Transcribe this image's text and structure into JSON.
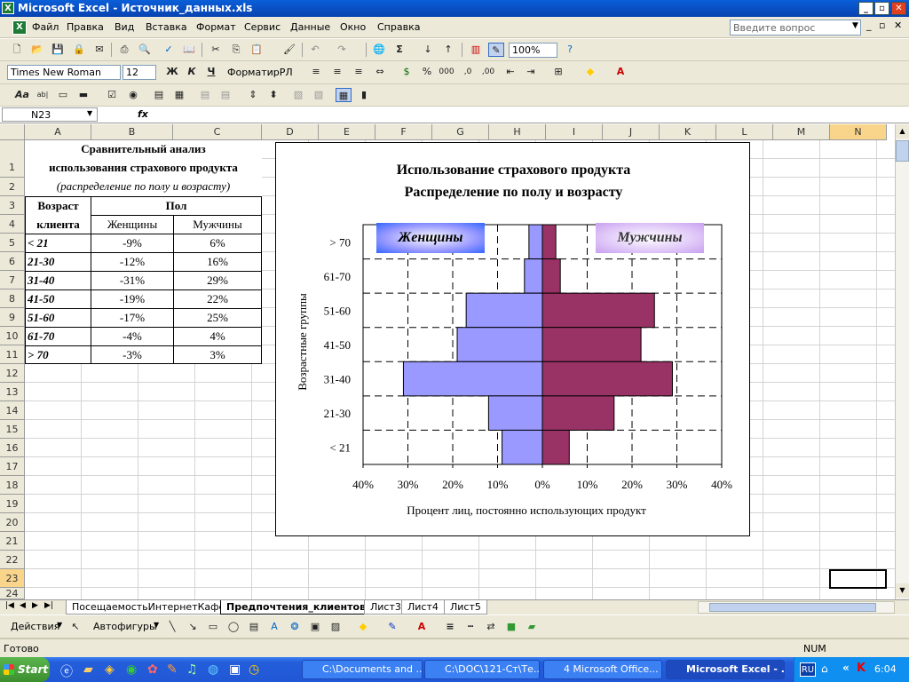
{
  "window": {
    "title": "Microsoft Excel - Источник_данных.xls"
  },
  "menu": [
    "Файл",
    "Правка",
    "Вид",
    "Вставка",
    "Формат",
    "Сервис",
    "Данные",
    "Окно",
    "Справка"
  ],
  "help_placeholder": "Введите вопрос",
  "toolbar": {
    "zoom": "100%",
    "font": "Times New Roman",
    "size": "12",
    "bold": "Ж",
    "italic": "К",
    "underline": "Ч",
    "format_btn": "ФорматирРЛ"
  },
  "formula_bar": {
    "cell": "N23",
    "fx": "fx",
    "value": ""
  },
  "columns": [
    "A",
    "B",
    "C",
    "D",
    "E",
    "F",
    "G",
    "H",
    "I",
    "J",
    "K",
    "L",
    "M",
    "N"
  ],
  "rows": [
    "1",
    "2",
    "3",
    "4",
    "5",
    "6",
    "7",
    "8",
    "9",
    "10",
    "11",
    "12",
    "13",
    "14",
    "15",
    "16",
    "17",
    "18",
    "19",
    "20",
    "21",
    "22",
    "23",
    "24"
  ],
  "table": {
    "title1": "Сравнительный анализ",
    "title2": "использования страхового продукта",
    "subtitle": "(распределение по полу и возрасту)",
    "h_age1": "Возраст",
    "h_age2": "клиента",
    "h_sex": "Пол",
    "h_women": "Женщины",
    "h_men": "Мужчины",
    "data": [
      {
        "age": "< 21",
        "women": "-9%",
        "men": "6%"
      },
      {
        "age": "21-30",
        "women": "-12%",
        "men": "16%"
      },
      {
        "age": "31-40",
        "women": "-31%",
        "men": "29%"
      },
      {
        "age": "41-50",
        "women": "-19%",
        "men": "22%"
      },
      {
        "age": "51-60",
        "women": "-17%",
        "men": "25%"
      },
      {
        "age": "61-70",
        "women": "-4%",
        "men": "4%"
      },
      {
        "age": "> 70",
        "women": "-3%",
        "men": "3%"
      }
    ]
  },
  "chart_data": {
    "type": "bar",
    "title": "Использование страхового продукта",
    "subtitle": "Распределение по полу и возрасту",
    "xlabel": "Процент лиц, постоянно использующих продукт",
    "ylabel": "Возрастные группы",
    "categories": [
      "> 70",
      "61-70",
      "51-60",
      "41-50",
      "31-40",
      "21-30",
      "< 21"
    ],
    "series": [
      {
        "name": "Женщины",
        "values": [
          -3,
          -4,
          -17,
          -19,
          -31,
          -12,
          -9
        ],
        "color": "#9999ff"
      },
      {
        "name": "Мужчины",
        "values": [
          3,
          4,
          25,
          22,
          29,
          16,
          6
        ],
        "color": "#993366"
      }
    ],
    "xticks": [
      "40%",
      "30%",
      "20%",
      "10%",
      "0%",
      "10%",
      "20%",
      "30%",
      "40%"
    ],
    "xlim": [
      -40,
      40
    ],
    "grid": true
  },
  "sheets": [
    "ПосещаемостьИнтернетКафе",
    "Предпочтения_клиентов",
    "Лист3",
    "Лист4",
    "Лист5"
  ],
  "active_sheet": 1,
  "drawbar": {
    "actions": "Действия",
    "autoshapes": "Автофигуры"
  },
  "status": {
    "left": "Готово",
    "num": "NUM"
  },
  "taskbar": {
    "start": "Start",
    "tasks": [
      "C:\\Documents and ...",
      "C:\\DOC\\121-Ст\\Те...",
      "4 Microsoft Office...",
      "Microsoft Excel - ..."
    ],
    "lang": "RU",
    "clock": "6:04"
  }
}
